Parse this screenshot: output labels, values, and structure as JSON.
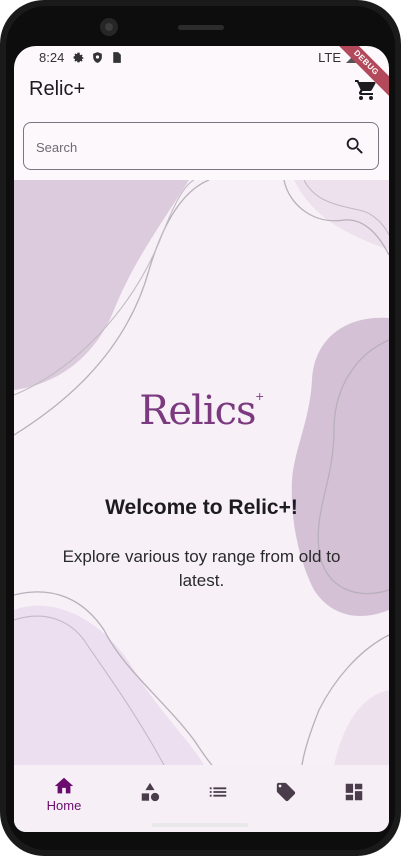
{
  "status_bar": {
    "time": "8:24",
    "network": "LTE",
    "debug_label": "DEBUG"
  },
  "app_bar": {
    "title": "Relic+",
    "cart_icon": "shopping-cart-icon"
  },
  "search": {
    "placeholder": "Search",
    "value": "",
    "icon": "search-icon"
  },
  "hero": {
    "logo_text": "Relics",
    "logo_plus": "+",
    "welcome_title": "Welcome to Relic+!",
    "subtitle": "Explore various toy range from old to latest."
  },
  "bottom_nav": {
    "items": [
      {
        "label": "Home",
        "icon": "home-icon",
        "active": true
      },
      {
        "label": "",
        "icon": "category-icon",
        "active": false
      },
      {
        "label": "",
        "icon": "list-icon",
        "active": false
      },
      {
        "label": "",
        "icon": "tag-icon",
        "active": false
      },
      {
        "label": "",
        "icon": "dashboard-icon",
        "active": false
      }
    ]
  },
  "colors": {
    "accent": "#6b0b6e",
    "nav_icon": "#4a3c4b",
    "hero_bg": "#f7f0f7",
    "blob_dark": "#d8c8da",
    "blob_light": "#efe2f1",
    "debug_banner": "#b24a5b"
  }
}
